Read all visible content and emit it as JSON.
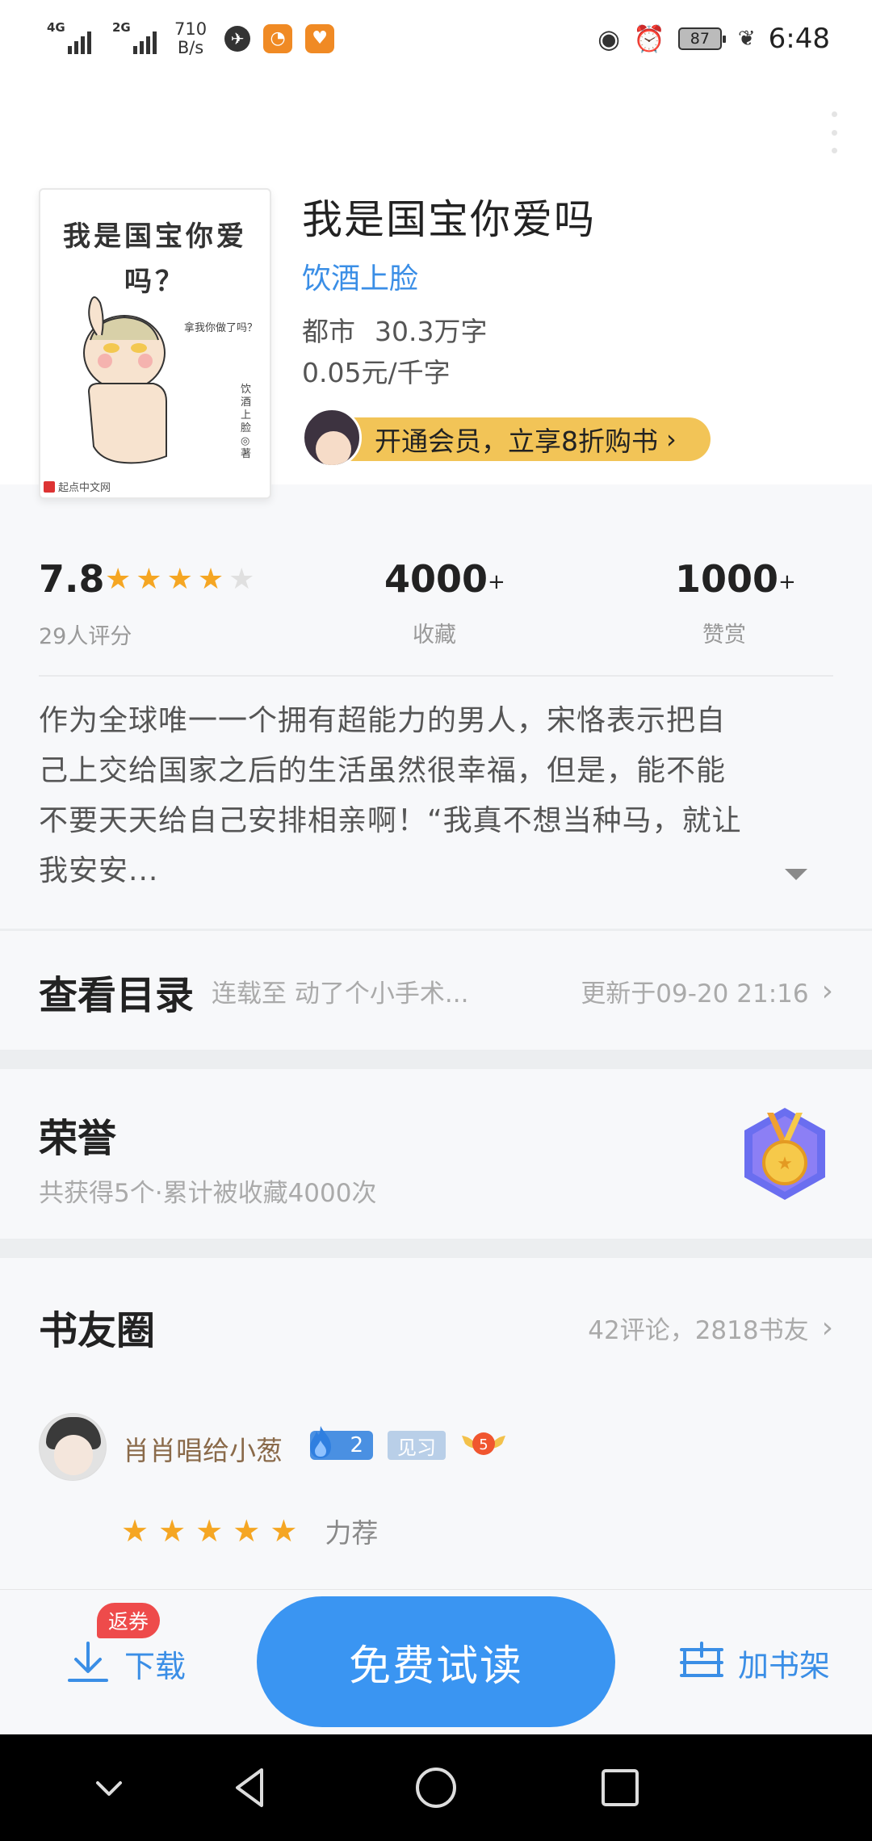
{
  "status_bar": {
    "net1": "4G",
    "net2": "2G",
    "speed_value": "710",
    "speed_unit": "B/s",
    "battery": "87",
    "time": "6:48"
  },
  "book": {
    "title": "我是国宝你爱吗",
    "author": "饮酒上脸",
    "category": "都市",
    "word_count": "30.3万字",
    "price": "0.05元/千字",
    "vip_banner": "开通会员，立享8折购书",
    "cover": {
      "title_line1": "我是国宝你爱",
      "title_line2": "吗？",
      "bubble": "拿我你做了吗？",
      "author_vertical": "饮酒上脸◎著",
      "publisher": "起点中文网"
    }
  },
  "stats": {
    "rating": "7.8",
    "rating_stars": 4,
    "rating_count": "29人评分",
    "collect_value": "4000",
    "collect_suffix": "+",
    "collect_label": "收藏",
    "reward_value": "1000",
    "reward_suffix": "+",
    "reward_label": "赞赏"
  },
  "synopsis": {
    "line1": "作为全球唯一一个拥有超能力的男人，宋恪表示把自",
    "line2": "己上交给国家之后的生活虽然很幸福，但是，能不能",
    "line3": "不要天天给自己安排相亲啊！“我真不想当种马，就让",
    "line4": "我安安..."
  },
  "toc": {
    "heading": "查看目录",
    "latest": "连载至 动了个小手术...",
    "updated": "更新于09-20 21:16"
  },
  "honor": {
    "heading": "荣誉",
    "summary": "共获得5个·累计被收藏4000次"
  },
  "circle": {
    "heading": "书友圈",
    "meta": "42评论，2818书友",
    "review": {
      "user": "肖肖唱给小葱",
      "fire_level": "2",
      "level_badge": "见习",
      "wing_level": "5",
      "rating_label": "力荐"
    }
  },
  "actions": {
    "coupon": "返券",
    "download": "下载",
    "read": "免费试读",
    "add_shelf": "加书架"
  },
  "colors": {
    "accent": "#3a95f2",
    "link": "#3a8ee6",
    "star": "#f5a623",
    "vip": "#f2c457",
    "coupon": "#ee4b4b"
  }
}
